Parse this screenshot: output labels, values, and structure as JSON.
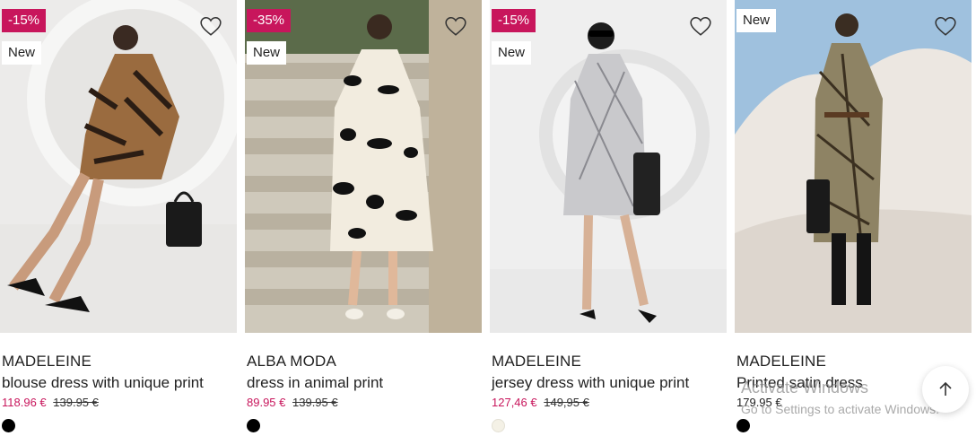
{
  "products": [
    {
      "badge_sale": "-15%",
      "badge_new": "New",
      "brand": "MADELEINE",
      "title": "blouse dress with unique print",
      "price": "118.96 €",
      "old_price": "139.95 €",
      "swatch_color": "#000000",
      "heart_icon": "heart-outline-icon"
    },
    {
      "badge_sale": "-35%",
      "badge_new": "New",
      "brand": "ALBA MODA",
      "title": "dress in animal print",
      "price": "89.95 €",
      "old_price": "139.95 €",
      "swatch_color": "#000000",
      "heart_icon": "heart-outline-icon"
    },
    {
      "badge_sale": "-15%",
      "badge_new": "New",
      "brand": "MADELEINE",
      "title": "jersey dress with unique print",
      "price": "127,46 €",
      "old_price": "149,95 €",
      "swatch_color": "#f4f1e6",
      "heart_icon": "heart-outline-icon"
    },
    {
      "badge_new": "New",
      "brand": "MADELEINE",
      "title": "Printed satin dress",
      "price": "179.95 €",
      "swatch_color": "#000000",
      "heart_icon": "heart-outline-icon"
    }
  ],
  "colors": {
    "sale_accent": "#c8165c"
  },
  "overlay": {
    "watermark_title": "Activate Windows",
    "watermark_sub": "Go to Settings to activate Windows.",
    "back_to_top_icon": "arrow-up-icon"
  }
}
